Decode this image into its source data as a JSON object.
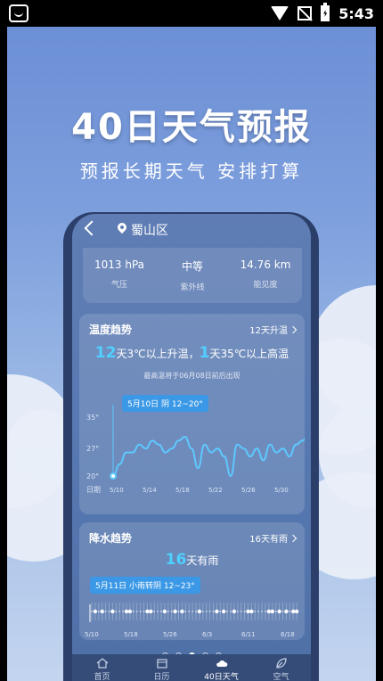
{
  "status_bar": {
    "time": "5:43"
  },
  "promo": {
    "title": "40日天气预报",
    "subtitle": "预报长期天气 安排打算"
  },
  "header": {
    "location": "蜀山区"
  },
  "stats": [
    {
      "value": "1013 hPa",
      "label": "气压"
    },
    {
      "value": "中等",
      "label": "紫外线"
    },
    {
      "value": "14.76 km",
      "label": "能见度"
    }
  ],
  "temp_trend": {
    "title": "温度趋势",
    "link": "12天升温",
    "summary_num1": "12",
    "summary_text1": "天3℃以上升温，",
    "summary_num2": "1",
    "summary_text2": "天35℃以上高温",
    "note": "最高温将于06月08日前后出现",
    "tooltip": "5月10日 阴 12~20°"
  },
  "rain_trend": {
    "title": "降水趋势",
    "link": "16天有雨",
    "summary_num": "16",
    "summary_text": "天有雨",
    "tooltip": "5月11日 小雨转阴 12~23°",
    "x_labels": [
      "5/10",
      "5/18",
      "5/26",
      "6/3",
      "6/11",
      "6/18"
    ]
  },
  "chart_data": {
    "type": "line",
    "title": "",
    "xlabel": "日期",
    "ylabel": "",
    "ylim": [
      20,
      35
    ],
    "y_ticks": [
      "35°",
      "27°",
      "20°"
    ],
    "x_tick_labels": [
      "5/10",
      "5/14",
      "5/18",
      "5/22",
      "5/26",
      "5/30",
      "6/3"
    ],
    "series": [
      {
        "values": [
          20,
          23,
          26,
          26,
          28,
          27,
          29,
          28,
          26,
          27,
          29,
          30,
          27,
          22,
          28,
          26,
          27,
          25,
          20,
          28,
          27,
          25,
          27,
          24,
          28,
          26,
          27,
          25,
          28,
          29,
          31
        ]
      }
    ]
  },
  "pager": {
    "count": 5,
    "active": 2
  },
  "nav": [
    {
      "label": "首页",
      "icon": "home-icon"
    },
    {
      "label": "日历",
      "icon": "calendar-icon"
    },
    {
      "label": "40日天气",
      "icon": "cloud-icon"
    },
    {
      "label": "空气",
      "icon": "leaf-icon"
    }
  ]
}
